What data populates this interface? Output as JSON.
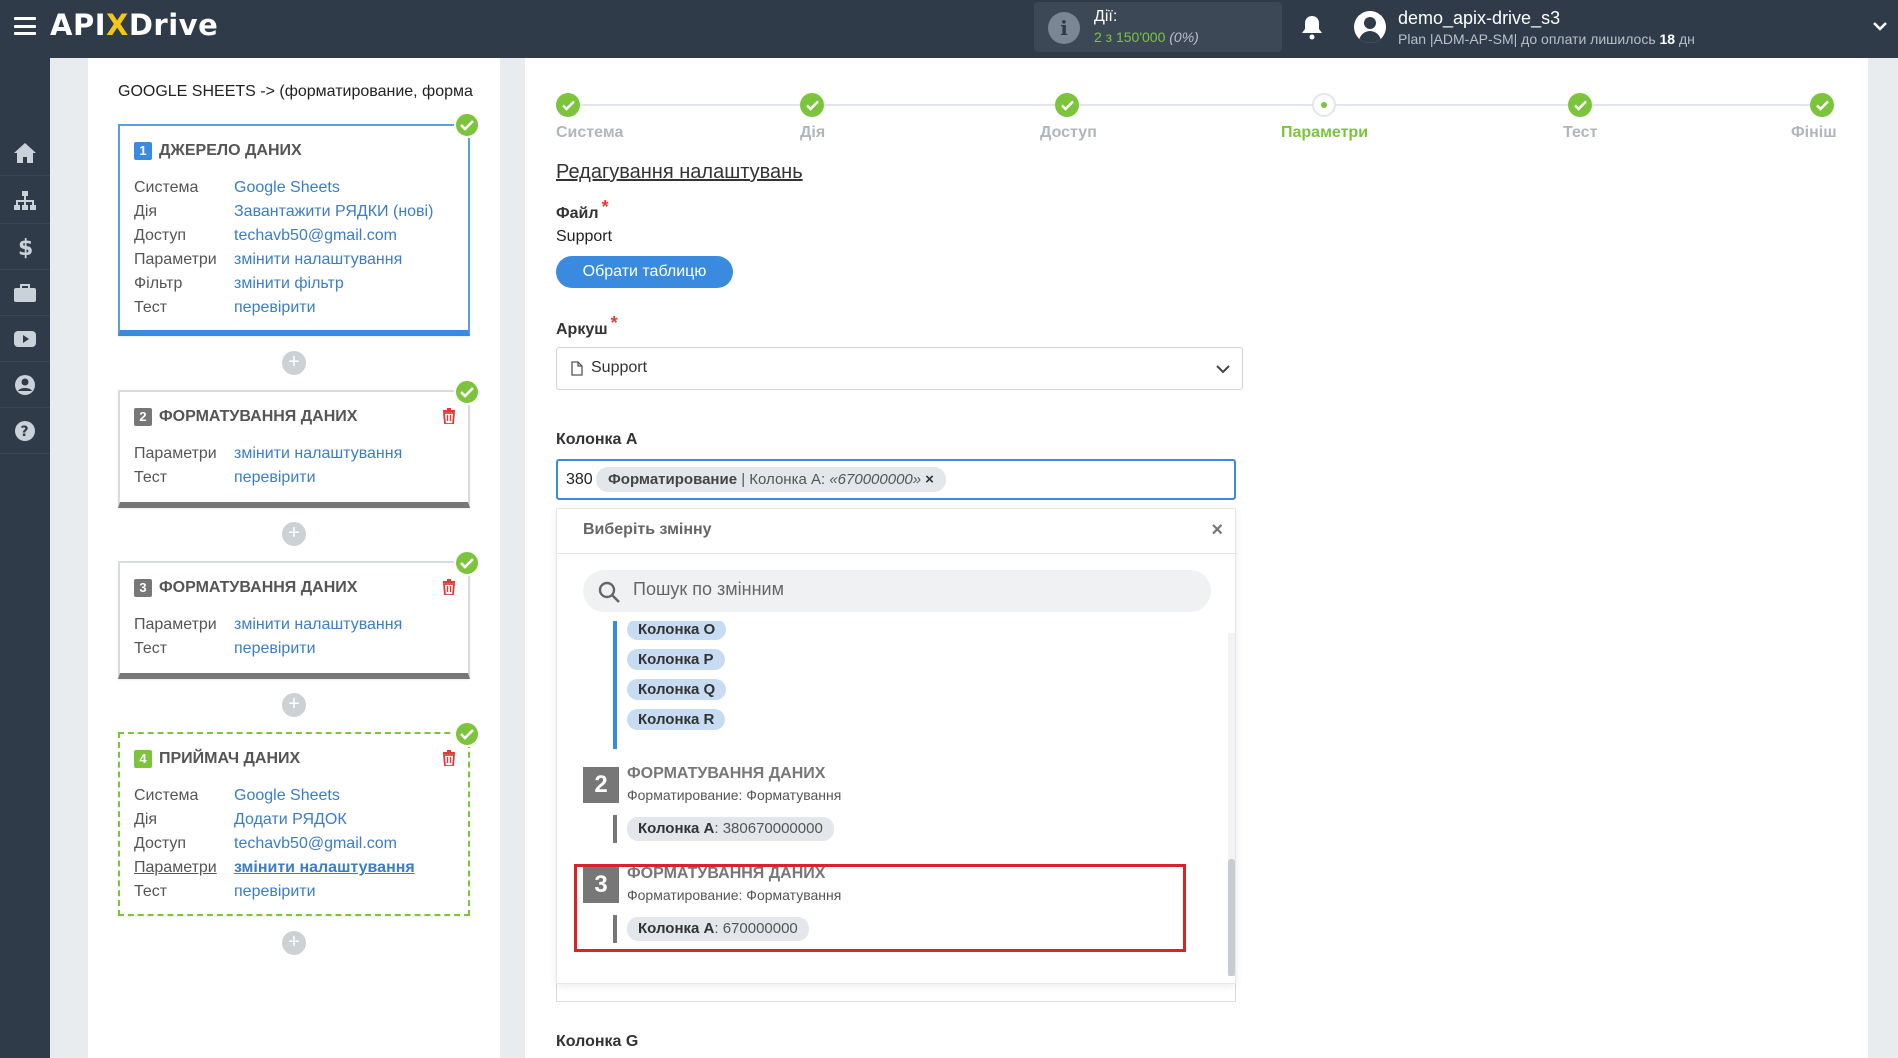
{
  "header": {
    "logo_prefix": "API",
    "logo_x": "X",
    "logo_suffix": "Drive",
    "actions_label": "Дії:",
    "actions_count_main": "2 з 150'000",
    "actions_count_pct": "(0%)",
    "user_name": "demo_apix-drive_s3",
    "user_plan_prefix": "Plan |ADM-AP-SM| до оплати лишилось",
    "user_plan_days": "18",
    "user_plan_suffix": "дн"
  },
  "sidebar": {
    "items": [
      "home-icon",
      "sitemap-icon",
      "dollar-icon",
      "briefcase-icon",
      "video-icon",
      "user-icon",
      "help-icon"
    ]
  },
  "left_panel": {
    "connection_title": "GOOGLE SHEETS -> (форматирование, формат",
    "blocks": [
      {
        "num": "1",
        "title": "ДЖЕРЕЛО ДАНИХ",
        "rows": [
          {
            "k": "Система",
            "v": "Google Sheets"
          },
          {
            "k": "Дія",
            "v": "Завантажити РЯДКИ (нові)"
          },
          {
            "k": "Доступ",
            "v": "techavb50@gmail.com"
          },
          {
            "k": "Параметри",
            "v": "змінити налаштування"
          },
          {
            "k": "Фільтр",
            "v": "змінити фільтр"
          },
          {
            "k": "Тест",
            "v": "перевірити"
          }
        ]
      },
      {
        "num": "2",
        "title": "ФОРМАТУВАННЯ ДАНИХ",
        "rows": [
          {
            "k": "Параметри",
            "v": "змінити налаштування"
          },
          {
            "k": "Тест",
            "v": "перевірити"
          }
        ]
      },
      {
        "num": "3",
        "title": "ФОРМАТУВАННЯ ДАНИХ",
        "rows": [
          {
            "k": "Параметри",
            "v": "змінити налаштування"
          },
          {
            "k": "Тест",
            "v": "перевірити"
          }
        ]
      },
      {
        "num": "4",
        "title": "ПРИЙМАЧ ДАНИХ",
        "rows": [
          {
            "k": "Система",
            "v": "Google Sheets"
          },
          {
            "k": "Дія",
            "v": "Додати РЯДОК"
          },
          {
            "k": "Доступ",
            "v": "techavb50@gmail.com"
          },
          {
            "k": "Параметри",
            "v": "змінити налаштування"
          },
          {
            "k": "Тест",
            "v": "перевірити"
          }
        ]
      }
    ],
    "plus": "+"
  },
  "steps": [
    "Система",
    "Дія",
    "Доступ",
    "Параметри",
    "Тест",
    "Фініш"
  ],
  "form": {
    "section_title": "Редагування налаштувань",
    "file_label": "Файл",
    "file_value": "Support",
    "select_button": "Обрати таблицю",
    "sheet_label": "Аркуш",
    "sheet_value": "Support",
    "column_a_label": "Колонка A",
    "column_a_prefix": "380",
    "tag_bold": "Форматирование",
    "tag_rest": " | Колонка A: ",
    "tag_value": "«670000000»",
    "tag_close": "×",
    "required": "*",
    "column_g_label": "Колонка G"
  },
  "dropdown": {
    "title": "Виберіть змінну",
    "close": "×",
    "search_placeholder": "Пошук по змінним",
    "source_chips": [
      "Колонка O",
      "Колонка P",
      "Колонка Q",
      "Колонка R"
    ],
    "groups": [
      {
        "num": "2",
        "title": "ФОРМАТУВАННЯ ДАНИХ",
        "subtitle": "Форматирование: Форматування",
        "chip_label": "Колонка A",
        "chip_value": ": 380670000000"
      },
      {
        "num": "3",
        "title": "ФОРМАТУВАННЯ ДАНИХ",
        "subtitle": "Форматирование: Форматування",
        "chip_label": "Колонка A",
        "chip_value": ": 670000000"
      }
    ]
  },
  "colors": {
    "topbar": "#2f3b49",
    "accent_blue": "#3a8be0",
    "success_green": "#7cc43c",
    "delete_red": "#e53935",
    "highlight_red": "#d9222a"
  }
}
